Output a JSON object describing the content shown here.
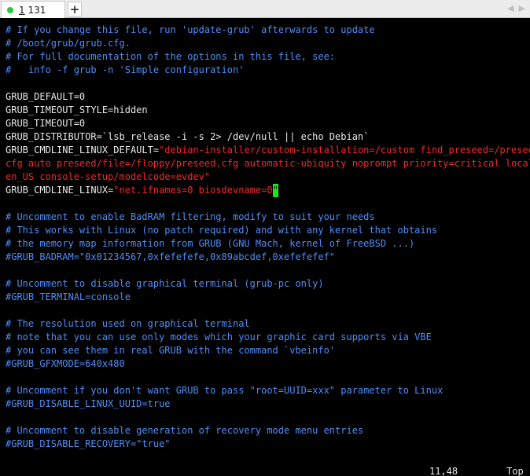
{
  "tab": {
    "title_num": "1",
    "title_rest": " 131",
    "status_color": "#28c840",
    "new_tab_glyph": "+",
    "nav_left_glyph": "◀",
    "nav_right_glyph": "▶"
  },
  "editor": {
    "lines": [
      [
        {
          "t": "# If you change this file, run 'update-grub' afterwards to update",
          "k": "c"
        }
      ],
      [
        {
          "t": "# /boot/grub/grub.cfg.",
          "k": "c"
        }
      ],
      [
        {
          "t": "# For full documentation of the options in this file, see:",
          "k": "c"
        }
      ],
      [
        {
          "t": "#   info -f grub -n 'Simple configuration'",
          "k": "c"
        }
      ],
      [],
      [
        {
          "t": "GRUB_DEFAULT=0",
          "k": "n"
        }
      ],
      [
        {
          "t": "GRUB_TIMEOUT_STYLE=hidden",
          "k": "n"
        }
      ],
      [
        {
          "t": "GRUB_TIMEOUT=0",
          "k": "n"
        }
      ],
      [
        {
          "t": "GRUB_DISTRIBUTOR=`lsb_release -i -s 2> /dev/null || echo Debian`",
          "k": "n"
        }
      ],
      [
        {
          "t": "GRUB_CMDLINE_LINUX_DEFAULT=",
          "k": "n"
        },
        {
          "t": "\"debian-installer/custom-installation=/custom find_preseed=/preseed.",
          "k": "s"
        }
      ],
      [
        {
          "t": "cfg auto preseed/file=/floppy/preseed.cfg automatic-ubiquity noprompt priority=critical locale=",
          "k": "s"
        }
      ],
      [
        {
          "t": "en_US console-setup/modelcode=evdev\"",
          "k": "s"
        }
      ],
      [
        {
          "t": "GRUB_CMDLINE_LINUX=",
          "k": "n"
        },
        {
          "t": "\"net.ifnames=0 biosdevname=0",
          "k": "s"
        },
        {
          "t": "\"",
          "k": "cursor"
        }
      ],
      [],
      [
        {
          "t": "# Uncomment to enable BadRAM filtering, modify to suit your needs",
          "k": "c"
        }
      ],
      [
        {
          "t": "# This works with Linux (no patch required) and with any kernel that obtains",
          "k": "c"
        }
      ],
      [
        {
          "t": "# the memory map information from GRUB (GNU Mach, kernel of FreeBSD ...)",
          "k": "c"
        }
      ],
      [
        {
          "t": "#GRUB_BADRAM=\"0x01234567,0xfefefefe,0x89abcdef,0xefefefef\"",
          "k": "c"
        }
      ],
      [],
      [
        {
          "t": "# Uncomment to disable graphical terminal (grub-pc only)",
          "k": "c"
        }
      ],
      [
        {
          "t": "#GRUB_TERMINAL=console",
          "k": "c"
        }
      ],
      [],
      [
        {
          "t": "# The resolution used on graphical terminal",
          "k": "c"
        }
      ],
      [
        {
          "t": "# note that you can use only modes which your graphic card supports via VBE",
          "k": "c"
        }
      ],
      [
        {
          "t": "# you can see them in real GRUB with the command `vbeinfo'",
          "k": "c"
        }
      ],
      [
        {
          "t": "#GRUB_GFXMODE=640x480",
          "k": "c"
        }
      ],
      [],
      [
        {
          "t": "# Uncomment if you don't want GRUB to pass \"root=UUID=xxx\" parameter to Linux",
          "k": "c"
        }
      ],
      [
        {
          "t": "#GRUB_DISABLE_LINUX_UUID=true",
          "k": "c"
        }
      ],
      [],
      [
        {
          "t": "# Uncomment to disable generation of recovery mode menu entries",
          "k": "c"
        }
      ],
      [
        {
          "t": "#GRUB_DISABLE_RECOVERY=\"true\"",
          "k": "c"
        }
      ]
    ],
    "colors": {
      "comment": "#4e8ef7",
      "string": "#ef2929",
      "text": "#e8e8e8",
      "cursor": "#19e619",
      "background": "#000000"
    }
  },
  "statusline": {
    "position": "11,48",
    "scroll": "Top"
  }
}
